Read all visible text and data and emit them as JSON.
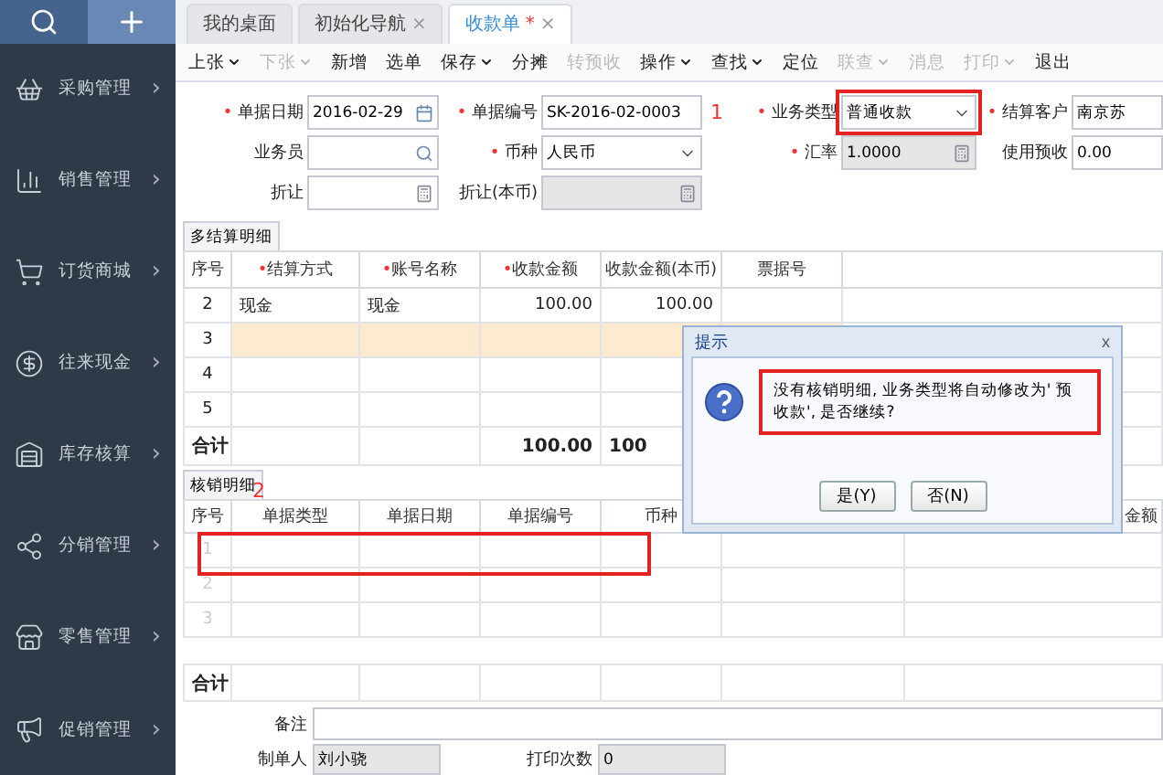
{
  "sidebar": {
    "items": [
      {
        "label": "采购管理",
        "arrow": "›"
      },
      {
        "label": "销售管理",
        "arrow": "›"
      },
      {
        "label": "订货商城",
        "arrow": "›"
      },
      {
        "label": "往来现金",
        "arrow": "›"
      },
      {
        "label": "库存核算",
        "arrow": "›"
      },
      {
        "label": "分销管理",
        "arrow": "›"
      },
      {
        "label": "零售管理",
        "arrow": "›"
      },
      {
        "label": "促销管理",
        "arrow": "›"
      }
    ]
  },
  "tabs": [
    {
      "label": "我的桌面",
      "selected": false
    },
    {
      "label": "初始化导航",
      "modified": false,
      "closable": true,
      "selected": false
    },
    {
      "label": "收款单",
      "modified": true,
      "closable": true,
      "selected": true
    }
  ],
  "tab_marks": {
    "modified": "*",
    "close": "×"
  },
  "required_mark": "•",
  "toolbar": [
    {
      "label": "上张",
      "dropdown": true,
      "disabled": false
    },
    {
      "label": "下张",
      "dropdown": true,
      "disabled": true
    },
    {
      "label": "新增",
      "dropdown": false,
      "disabled": false
    },
    {
      "label": "选单",
      "dropdown": false,
      "disabled": false
    },
    {
      "label": "保存",
      "dropdown": true,
      "disabled": false
    },
    {
      "label": "分摊",
      "dropdown": false,
      "disabled": false
    },
    {
      "label": "转预收",
      "dropdown": false,
      "disabled": true
    },
    {
      "label": "操作",
      "dropdown": true,
      "disabled": false
    },
    {
      "label": "查找",
      "dropdown": true,
      "disabled": false
    },
    {
      "label": "定位",
      "dropdown": false,
      "disabled": false
    },
    {
      "label": "联查",
      "dropdown": true,
      "disabled": true
    },
    {
      "label": "消息",
      "dropdown": false,
      "disabled": true
    },
    {
      "label": "打印",
      "dropdown": true,
      "disabled": true
    },
    {
      "label": "退出",
      "dropdown": false,
      "disabled": false
    }
  ],
  "form": {
    "rows": [
      [
        {
          "label": "单据日期",
          "required": true,
          "value": "2016-02-29",
          "kind": "date",
          "disabled": false
        },
        {
          "label": "单据编号",
          "required": true,
          "value": "SK-2016-02-0003",
          "kind": "text",
          "disabled": false
        },
        {
          "label": "业务类型",
          "required": true,
          "value": "普通收款",
          "kind": "select",
          "disabled": false
        },
        {
          "label": "结算客户",
          "required": true,
          "value": "南京苏",
          "kind": "text",
          "disabled": false
        }
      ],
      [
        {
          "label": "业务员",
          "required": false,
          "kind": "search",
          "disabled": false
        },
        {
          "label": "币种",
          "required": true,
          "value": "人民币",
          "kind": "select",
          "disabled": false
        },
        {
          "label": "汇率",
          "required": true,
          "value": "1.0000",
          "kind": "calc",
          "disabled": true
        },
        {
          "label": "使用预收",
          "required": false,
          "value": "0.00",
          "kind": "text",
          "disabled": false
        }
      ],
      [
        {
          "label": "折让",
          "required": false,
          "kind": "calc",
          "disabled": false
        },
        {
          "label": "折让(本币)",
          "required": false,
          "kind": "calc",
          "disabled": true
        }
      ]
    ]
  },
  "settlement": {
    "title": "多结算明细",
    "columns": [
      {
        "label": "序号",
        "required": false
      },
      {
        "label": "结算方式",
        "required": true
      },
      {
        "label": "账号名称",
        "required": true
      },
      {
        "label": "收款金额",
        "required": true
      },
      {
        "label": "收款金额(本币)",
        "required": false
      },
      {
        "label": "票据号",
        "required": false
      }
    ],
    "rows": [
      {
        "cells": [
          "2",
          "现金",
          "现金",
          "100.00",
          "100.00",
          ""
        ],
        "selected": false
      },
      {
        "cells": [
          "3",
          "",
          "",
          "",
          "",
          ""
        ],
        "selected": true
      },
      {
        "cells": [
          "4",
          "",
          "",
          "",
          "",
          ""
        ],
        "selected": false
      },
      {
        "cells": [
          "5",
          "",
          "",
          "",
          "",
          ""
        ],
        "selected": false
      }
    ],
    "total": {
      "label": "合计",
      "cells": [
        "",
        "",
        "100.00",
        "100"
      ]
    }
  },
  "writeoff": {
    "title": "核销明细",
    "columns": [
      "序号",
      "单据类型",
      "单据日期",
      "单据编号",
      "币种"
    ],
    "last_column": "金额",
    "rows": [
      "1",
      "2",
      "3"
    ],
    "total": {
      "label": "合计"
    }
  },
  "footer": {
    "remark": {
      "label": "备注"
    },
    "creator": {
      "label": "制单人",
      "value": "刘小骁",
      "disabled": true
    },
    "print_count": {
      "label": "打印次数",
      "value": "0",
      "disabled": true
    }
  },
  "annotations": [
    "1",
    "2"
  ],
  "dialog": {
    "title": "提示",
    "close": "x",
    "message": "没有核销明细, 业务类型将自动修改为' 预收款', 是否继续?",
    "buttons": [
      "是(Y)",
      "否(N)"
    ]
  }
}
